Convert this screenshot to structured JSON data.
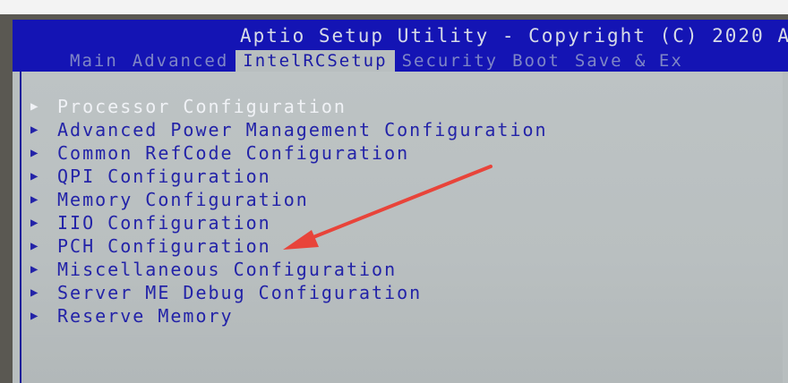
{
  "title": "Aptio Setup Utility - Copyright (C) 2020 A",
  "tabs": [
    {
      "label": "Main",
      "active": false
    },
    {
      "label": "Advanced",
      "active": false
    },
    {
      "label": "IntelRCSetup",
      "active": true
    },
    {
      "label": "Security",
      "active": false
    },
    {
      "label": "Boot",
      "active": false
    },
    {
      "label": "Save & Ex",
      "active": false
    }
  ],
  "menu": [
    {
      "label": "Processor Configuration",
      "selected": true
    },
    {
      "label": "Advanced Power Management Configuration",
      "selected": false
    },
    {
      "label": "Common RefCode Configuration",
      "selected": false
    },
    {
      "label": "QPI Configuration",
      "selected": false
    },
    {
      "label": "Memory Configuration",
      "selected": false
    },
    {
      "label": "IIO Configuration",
      "selected": false
    },
    {
      "label": "PCH Configuration",
      "selected": false
    },
    {
      "label": "Miscellaneous Configuration",
      "selected": false
    },
    {
      "label": "Server ME Debug Configuration",
      "selected": false
    },
    {
      "label": "Reserve Memory",
      "selected": false
    }
  ],
  "icons": {
    "submenu": "triangle-right-icon",
    "annotation": "red-arrow-icon"
  },
  "colors": {
    "header": "#1414b4",
    "body": "#b8bebf",
    "text": "#2323a8",
    "highlight": "#f0f2f6",
    "arrow": "#e8443a"
  }
}
